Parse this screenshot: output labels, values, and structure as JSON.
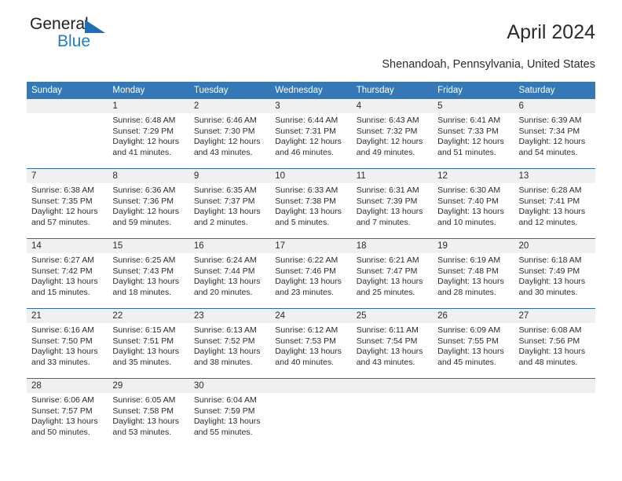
{
  "brand": {
    "name_top": "General",
    "name_bottom": "Blue",
    "triangle_color": "#1f6fb4",
    "bottom_color": "#1f7ec4"
  },
  "header": {
    "title": "April 2024",
    "subtitle": "Shenandoah, Pennsylvania, United States"
  },
  "colors": {
    "header_bar": "#3479b5",
    "week_divider": "#2e6da4",
    "daynum_band": "#f0f0f0",
    "text": "#2b2b2b"
  },
  "weekdays": [
    "Sunday",
    "Monday",
    "Tuesday",
    "Wednesday",
    "Thursday",
    "Friday",
    "Saturday"
  ],
  "weeks": [
    [
      {
        "day": "",
        "lines": []
      },
      {
        "day": "1",
        "lines": [
          "Sunrise: 6:48 AM",
          "Sunset: 7:29 PM",
          "Daylight: 12 hours",
          "and 41 minutes."
        ]
      },
      {
        "day": "2",
        "lines": [
          "Sunrise: 6:46 AM",
          "Sunset: 7:30 PM",
          "Daylight: 12 hours",
          "and 43 minutes."
        ]
      },
      {
        "day": "3",
        "lines": [
          "Sunrise: 6:44 AM",
          "Sunset: 7:31 PM",
          "Daylight: 12 hours",
          "and 46 minutes."
        ]
      },
      {
        "day": "4",
        "lines": [
          "Sunrise: 6:43 AM",
          "Sunset: 7:32 PM",
          "Daylight: 12 hours",
          "and 49 minutes."
        ]
      },
      {
        "day": "5",
        "lines": [
          "Sunrise: 6:41 AM",
          "Sunset: 7:33 PM",
          "Daylight: 12 hours",
          "and 51 minutes."
        ]
      },
      {
        "day": "6",
        "lines": [
          "Sunrise: 6:39 AM",
          "Sunset: 7:34 PM",
          "Daylight: 12 hours",
          "and 54 minutes."
        ]
      }
    ],
    [
      {
        "day": "7",
        "lines": [
          "Sunrise: 6:38 AM",
          "Sunset: 7:35 PM",
          "Daylight: 12 hours",
          "and 57 minutes."
        ]
      },
      {
        "day": "8",
        "lines": [
          "Sunrise: 6:36 AM",
          "Sunset: 7:36 PM",
          "Daylight: 12 hours",
          "and 59 minutes."
        ]
      },
      {
        "day": "9",
        "lines": [
          "Sunrise: 6:35 AM",
          "Sunset: 7:37 PM",
          "Daylight: 13 hours",
          "and 2 minutes."
        ]
      },
      {
        "day": "10",
        "lines": [
          "Sunrise: 6:33 AM",
          "Sunset: 7:38 PM",
          "Daylight: 13 hours",
          "and 5 minutes."
        ]
      },
      {
        "day": "11",
        "lines": [
          "Sunrise: 6:31 AM",
          "Sunset: 7:39 PM",
          "Daylight: 13 hours",
          "and 7 minutes."
        ]
      },
      {
        "day": "12",
        "lines": [
          "Sunrise: 6:30 AM",
          "Sunset: 7:40 PM",
          "Daylight: 13 hours",
          "and 10 minutes."
        ]
      },
      {
        "day": "13",
        "lines": [
          "Sunrise: 6:28 AM",
          "Sunset: 7:41 PM",
          "Daylight: 13 hours",
          "and 12 minutes."
        ]
      }
    ],
    [
      {
        "day": "14",
        "lines": [
          "Sunrise: 6:27 AM",
          "Sunset: 7:42 PM",
          "Daylight: 13 hours",
          "and 15 minutes."
        ]
      },
      {
        "day": "15",
        "lines": [
          "Sunrise: 6:25 AM",
          "Sunset: 7:43 PM",
          "Daylight: 13 hours",
          "and 18 minutes."
        ]
      },
      {
        "day": "16",
        "lines": [
          "Sunrise: 6:24 AM",
          "Sunset: 7:44 PM",
          "Daylight: 13 hours",
          "and 20 minutes."
        ]
      },
      {
        "day": "17",
        "lines": [
          "Sunrise: 6:22 AM",
          "Sunset: 7:46 PM",
          "Daylight: 13 hours",
          "and 23 minutes."
        ]
      },
      {
        "day": "18",
        "lines": [
          "Sunrise: 6:21 AM",
          "Sunset: 7:47 PM",
          "Daylight: 13 hours",
          "and 25 minutes."
        ]
      },
      {
        "day": "19",
        "lines": [
          "Sunrise: 6:19 AM",
          "Sunset: 7:48 PM",
          "Daylight: 13 hours",
          "and 28 minutes."
        ]
      },
      {
        "day": "20",
        "lines": [
          "Sunrise: 6:18 AM",
          "Sunset: 7:49 PM",
          "Daylight: 13 hours",
          "and 30 minutes."
        ]
      }
    ],
    [
      {
        "day": "21",
        "lines": [
          "Sunrise: 6:16 AM",
          "Sunset: 7:50 PM",
          "Daylight: 13 hours",
          "and 33 minutes."
        ]
      },
      {
        "day": "22",
        "lines": [
          "Sunrise: 6:15 AM",
          "Sunset: 7:51 PM",
          "Daylight: 13 hours",
          "and 35 minutes."
        ]
      },
      {
        "day": "23",
        "lines": [
          "Sunrise: 6:13 AM",
          "Sunset: 7:52 PM",
          "Daylight: 13 hours",
          "and 38 minutes."
        ]
      },
      {
        "day": "24",
        "lines": [
          "Sunrise: 6:12 AM",
          "Sunset: 7:53 PM",
          "Daylight: 13 hours",
          "and 40 minutes."
        ]
      },
      {
        "day": "25",
        "lines": [
          "Sunrise: 6:11 AM",
          "Sunset: 7:54 PM",
          "Daylight: 13 hours",
          "and 43 minutes."
        ]
      },
      {
        "day": "26",
        "lines": [
          "Sunrise: 6:09 AM",
          "Sunset: 7:55 PM",
          "Daylight: 13 hours",
          "and 45 minutes."
        ]
      },
      {
        "day": "27",
        "lines": [
          "Sunrise: 6:08 AM",
          "Sunset: 7:56 PM",
          "Daylight: 13 hours",
          "and 48 minutes."
        ]
      }
    ],
    [
      {
        "day": "28",
        "lines": [
          "Sunrise: 6:06 AM",
          "Sunset: 7:57 PM",
          "Daylight: 13 hours",
          "and 50 minutes."
        ]
      },
      {
        "day": "29",
        "lines": [
          "Sunrise: 6:05 AM",
          "Sunset: 7:58 PM",
          "Daylight: 13 hours",
          "and 53 minutes."
        ]
      },
      {
        "day": "30",
        "lines": [
          "Sunrise: 6:04 AM",
          "Sunset: 7:59 PM",
          "Daylight: 13 hours",
          "and 55 minutes."
        ]
      },
      {
        "day": "",
        "lines": []
      },
      {
        "day": "",
        "lines": []
      },
      {
        "day": "",
        "lines": []
      },
      {
        "day": "",
        "lines": []
      }
    ]
  ]
}
